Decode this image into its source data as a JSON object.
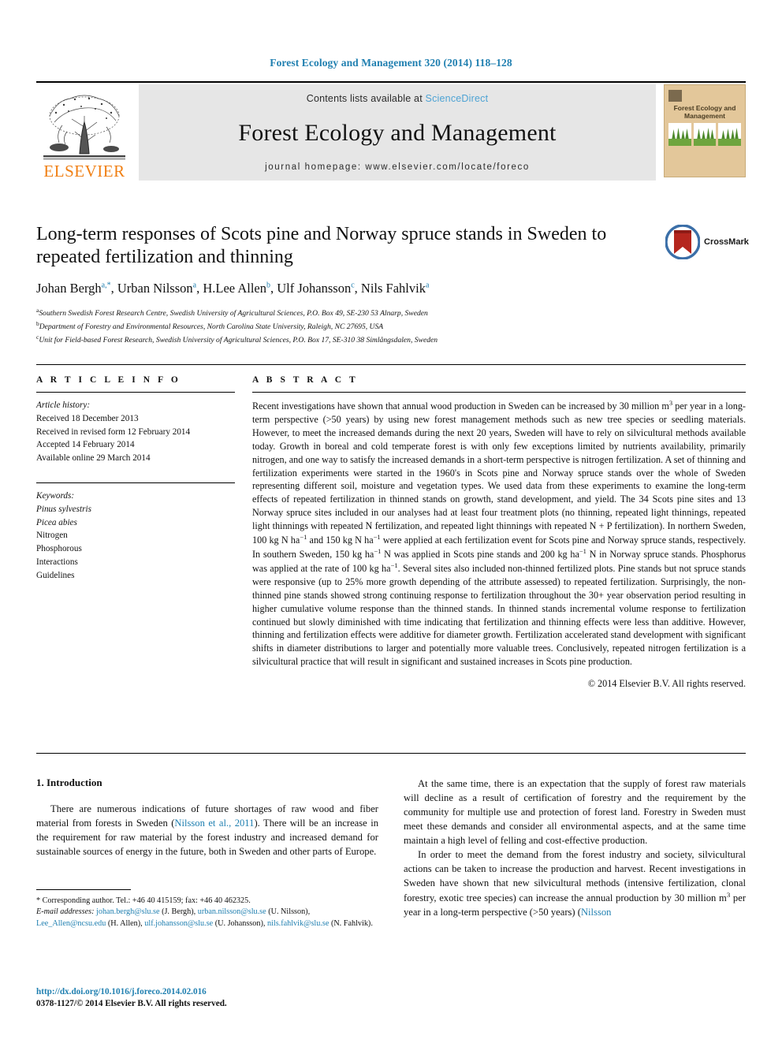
{
  "running_head": "Forest Ecology and Management 320 (2014) 118–128",
  "masthead": {
    "contents_prefix": "Contents lists available at ",
    "sciencedirect": "ScienceDirect",
    "journal_title": "Forest Ecology and Management",
    "homepage": "journal homepage: www.elsevier.com/locate/foreco",
    "publisher_wordmark": "ELSEVIER",
    "cover_title": "Forest Ecology and Management",
    "colors": {
      "link_blue": "#1f7fb0",
      "sciencedirect_blue": "#4ea3d4",
      "elsevier_orange": "#f07f13",
      "band_grey": "#e6e6e6",
      "cover_tan": "#e3c79a",
      "cover_green": "#6ea53e"
    }
  },
  "article": {
    "title": "Long-term responses of Scots pine and Norway spruce stands in Sweden to repeated fertilization and thinning",
    "crossmark_label": "CrossMark",
    "authors": [
      {
        "name": "Johan Bergh",
        "marks": "a,*"
      },
      {
        "name": "Urban Nilsson",
        "marks": "a"
      },
      {
        "name": "H.Lee Allen",
        "marks": "b"
      },
      {
        "name": "Ulf Johansson",
        "marks": "c"
      },
      {
        "name": "Nils Fahlvik",
        "marks": "a"
      }
    ],
    "affiliations": [
      {
        "mark": "a",
        "text": "Southern Swedish Forest Research Centre, Swedish University of Agricultural Sciences, P.O. Box 49, SE-230 53 Alnarp, Sweden"
      },
      {
        "mark": "b",
        "text": "Department of Forestry and Environmental Resources, North Carolina State University, Raleigh, NC 27695, USA"
      },
      {
        "mark": "c",
        "text": "Unit for Field-based Forest Research, Swedish University of Agricultural Sciences, P.O. Box 17, SE-310 38 Simlångsdalen, Sweden"
      }
    ]
  },
  "article_info": {
    "heading": "A R T I C L E   I N F O",
    "history_label": "Article history:",
    "history": [
      "Received 18 December 2013",
      "Received in revised form 12 February 2014",
      "Accepted 14 February 2014",
      "Available online 29 March 2014"
    ],
    "keywords_label": "Keywords:",
    "keywords": [
      {
        "text": "Pinus sylvestris",
        "italic": true
      },
      {
        "text": "Picea abies",
        "italic": true
      },
      {
        "text": "Nitrogen",
        "italic": false
      },
      {
        "text": "Phosphorous",
        "italic": false
      },
      {
        "text": "Interactions",
        "italic": false
      },
      {
        "text": "Guidelines",
        "italic": false
      }
    ]
  },
  "abstract": {
    "heading": "A B S T R A C T",
    "part1": "Recent investigations have shown that annual wood production in Sweden can be increased by 30 million m",
    "sup1": "3",
    "part2": " per year in a long-term perspective (>50 years) by using new forest management methods such as new tree species or seedling materials. However, to meet the increased demands during the next 20 years, Sweden will have to rely on silvicultural methods available today. Growth in boreal and cold temperate forest is with only few exceptions limited by nutrients availability, primarily nitrogen, and one way to satisfy the increased demands in a short-term perspective is nitrogen fertilization. A set of thinning and fertilization experiments were started in the 1960's in Scots pine and Norway spruce stands over the whole of Sweden representing different soil, moisture and vegetation types. We used data from these experiments to examine the long-term effects of repeated fertilization in thinned stands on growth, stand development, and yield. The 34 Scots pine sites and 13 Norway spruce sites included in our analyses had at least four treatment plots (no thinning, repeated light thinnings, repeated light thinnings with repeated N fertilization, and repeated light thinnings with repeated N + P fertilization). In northern Sweden, 100 kg N ha",
    "sup2": "−1",
    "part3": " and 150 kg N ha",
    "sup3": "−1",
    "part4": " were applied at each fertilization event for Scots pine and Norway spruce stands, respectively. In southern Sweden, 150 kg ha",
    "sup4": "−1",
    "part5": " N was applied in Scots pine stands and 200 kg ha",
    "sup5": "−1",
    "part6": " N in Norway spruce stands. Phosphorus was applied at the rate of 100 kg ha",
    "sup6": "−1",
    "part7": ". Several sites also included non-thinned fertilized plots. Pine stands but not spruce stands were responsive (up to 25% more growth depending of the attribute assessed) to repeated fertilization. Surprisingly, the non-thinned pine stands showed strong continuing response to fertilization throughout the 30+ year observation period resulting in higher cumulative volume response than the thinned stands. In thinned stands incremental volume response to fertilization continued but slowly diminished with time indicating that fertilization and thinning effects were less than additive. However, thinning and fertilization effects were additive for diameter growth. Fertilization accelerated stand development with significant shifts in diameter distributions to larger and potentially more valuable trees. Conclusively, repeated nitrogen fertilization is a silvicultural practice that will result in significant and sustained increases in Scots pine production.",
    "copyright": "© 2014 Elsevier B.V. All rights reserved."
  },
  "introduction": {
    "heading": "1. Introduction",
    "left_p1_a": "There are numerous indications of future shortages of raw wood and fiber material from forests in Sweden (",
    "left_p1_cite": "Nilsson et al., 2011",
    "left_p1_b": "). There will be an increase in the requirement for raw material by the forest industry and increased demand for sustainable sources of energy in the future, both in Sweden and other parts of Europe.",
    "right_p1": "At the same time, there is an expectation that the supply of forest raw materials will decline as a result of certification of forestry and the requirement by the community for multiple use and protection of forest land. Forestry in Sweden must meet these demands and consider all environmental aspects, and at the same time maintain a high level of felling and cost-effective production.",
    "right_p2_a": "In order to meet the demand from the forest industry and society, silvicultural actions can be taken to increase the production and harvest. Recent investigations in Sweden have shown that new silvicultural methods (intensive fertilization, clonal forestry, exotic tree species) can increase the annual production by 30 million m",
    "right_p2_sup": "3",
    "right_p2_b": " per year in a long-term perspective (>50 years) (",
    "right_p2_cite": "Nilsson"
  },
  "footnote": {
    "corresponding": "* Corresponding author. Tel.: +46 40 415159; fax: +46 40 462325.",
    "email_label": "E-mail addresses:",
    "emails": [
      {
        "address": "johan.bergh@slu.se",
        "person": "(J. Bergh)"
      },
      {
        "address": "urban.nilsson@slu.se",
        "person": "(U. Nilsson)"
      },
      {
        "address": "Lee_Allen@ncsu.edu",
        "person": "(H. Allen)"
      },
      {
        "address": "ulf.johansson@slu.se",
        "person": "(U. Johansson)"
      },
      {
        "address": "nils.fahlvik@slu.se",
        "person": "(N. Fahlvik)"
      }
    ],
    "doi": "http://dx.doi.org/10.1016/j.foreco.2014.02.016",
    "issn": "0378-1127/© 2014 Elsevier B.V. All rights reserved."
  }
}
